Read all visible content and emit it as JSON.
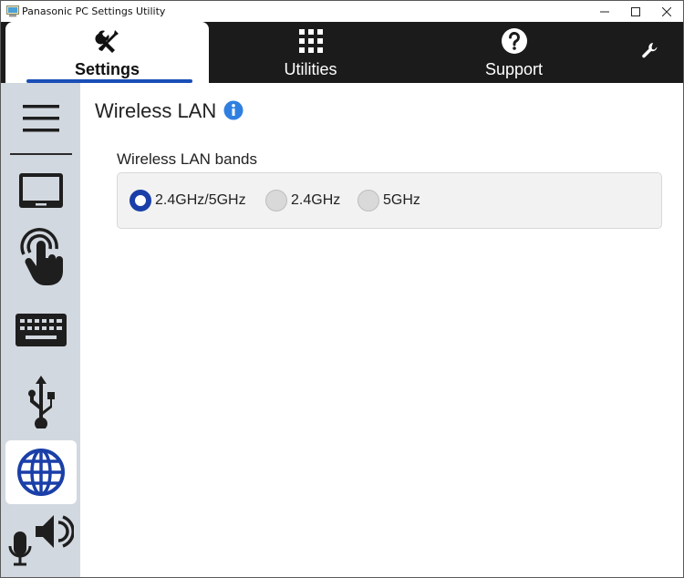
{
  "window": {
    "title": "Panasonic PC Settings Utility",
    "minimize": "minimize",
    "maximize": "maximize",
    "close": "close"
  },
  "topnav": {
    "tabs": [
      {
        "label": "Settings",
        "icon": "tools-icon",
        "active": true
      },
      {
        "label": "Utilities",
        "icon": "grid-icon",
        "active": false
      },
      {
        "label": "Support",
        "icon": "help-icon",
        "active": false
      }
    ],
    "tools_icon": "wrench-icon"
  },
  "sidebar": {
    "items": [
      {
        "icon": "menu-icon",
        "active": false
      },
      {
        "icon": "display-icon",
        "active": false
      },
      {
        "icon": "touch-icon",
        "active": false
      },
      {
        "icon": "keyboard-icon",
        "active": false
      },
      {
        "icon": "usb-icon",
        "active": false
      },
      {
        "icon": "globe-icon",
        "active": true
      },
      {
        "icon": "audio-icon",
        "active": false
      }
    ]
  },
  "main": {
    "title": "Wireless LAN",
    "info_icon": "info-icon",
    "group_label": "Wireless LAN bands",
    "options": [
      {
        "label": "2.4GHz/5GHz",
        "checked": true
      },
      {
        "label": "2.4GHz",
        "checked": false
      },
      {
        "label": "5GHz",
        "checked": false
      }
    ]
  },
  "colors": {
    "accent": "#1b4fb7",
    "nav_bg": "#1b1b1b",
    "sidebar_bg": "#d2d8df"
  }
}
